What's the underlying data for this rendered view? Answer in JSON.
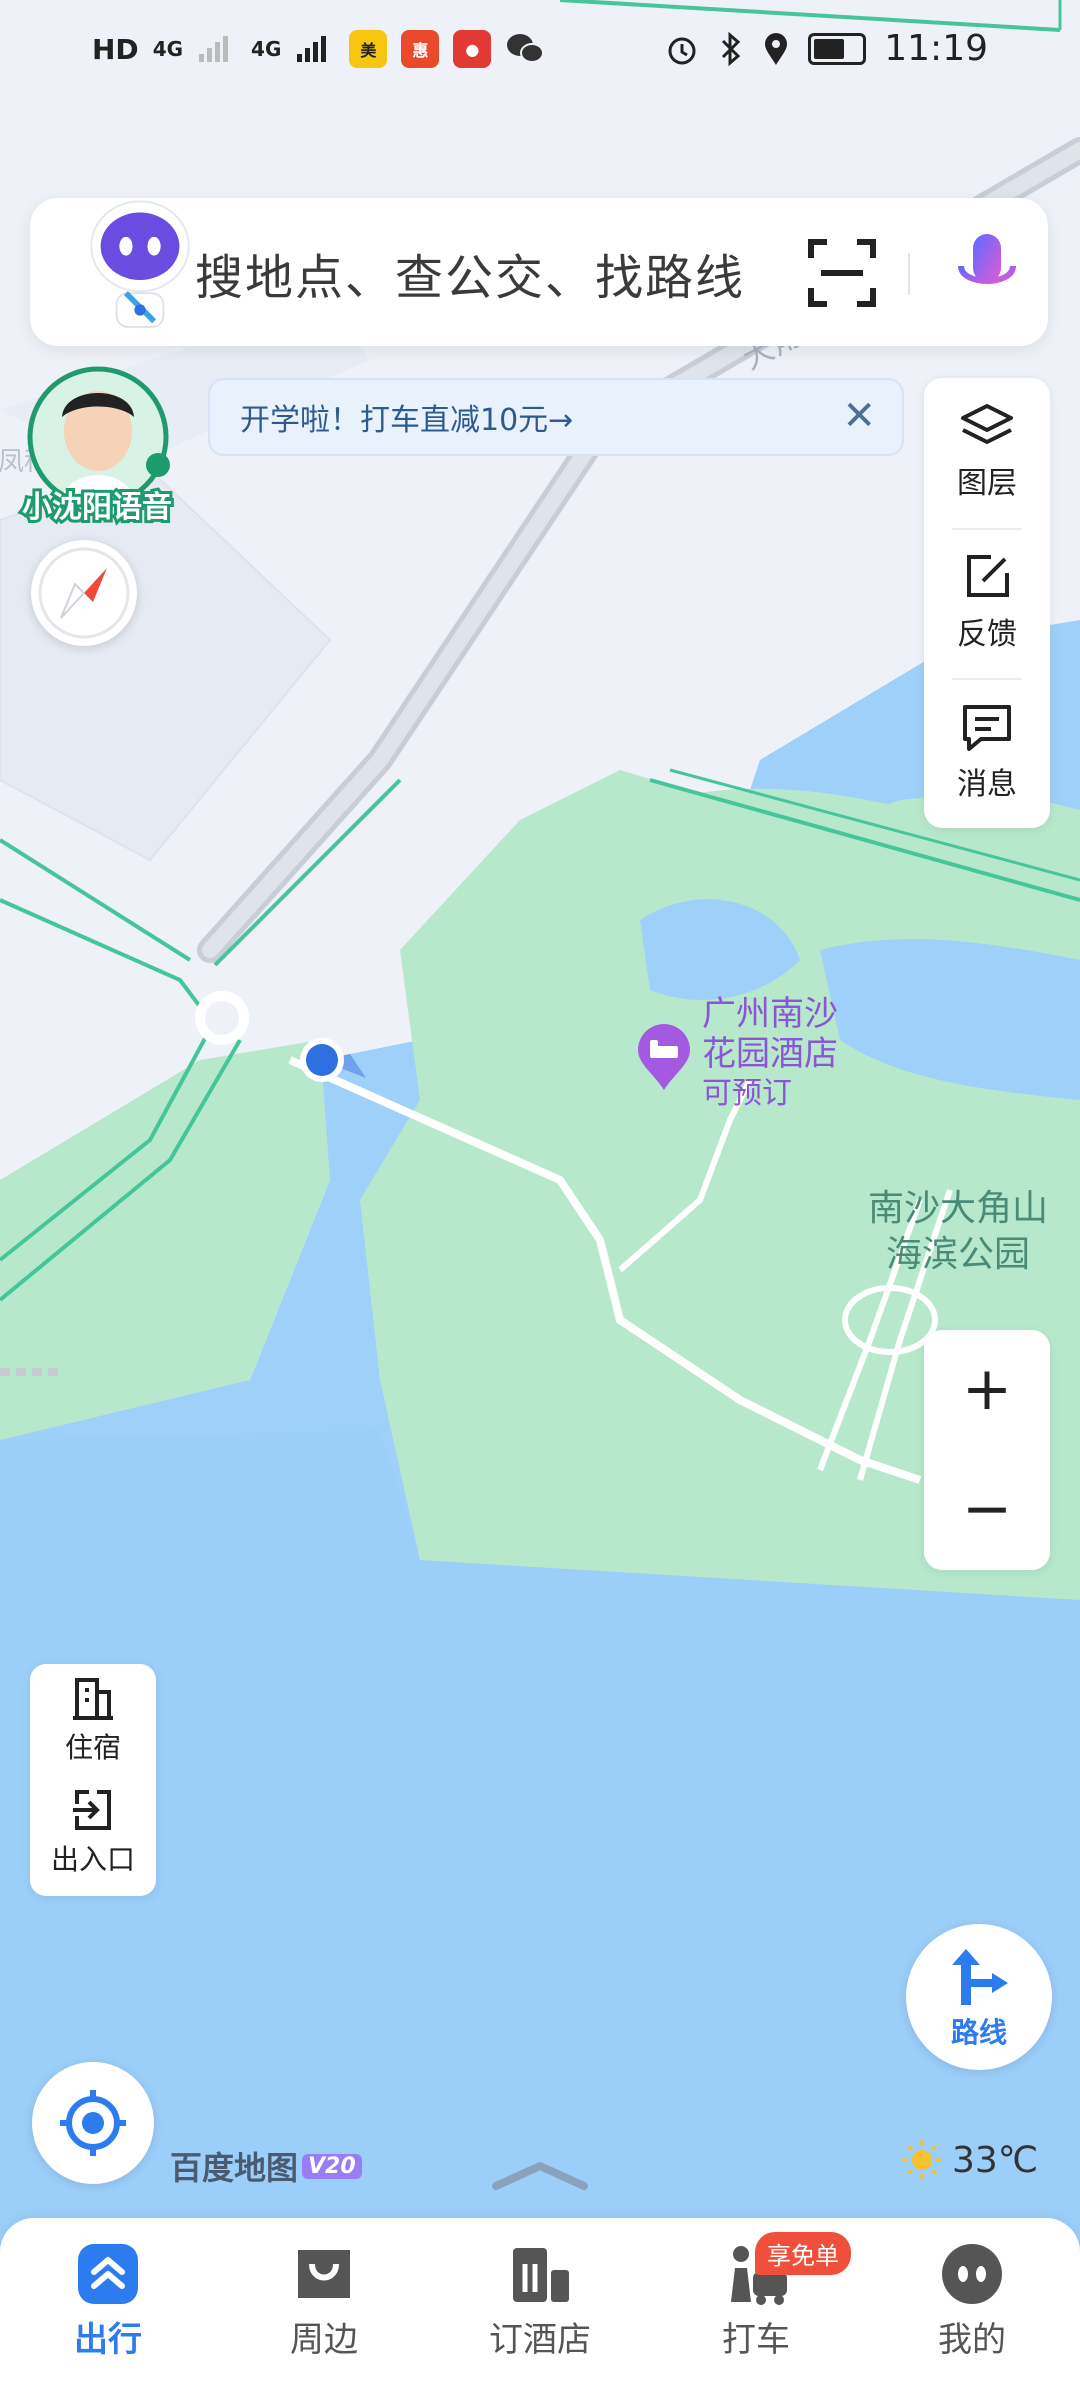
{
  "status_bar": {
    "hd": "HD",
    "net1": "4G",
    "net2": "4G",
    "time": "11:19",
    "apps": [
      "meituan-icon",
      "app-red-icon",
      "recorder-icon",
      "wechat-icon"
    ]
  },
  "search": {
    "placeholder": "搜地点、查公交、找路线"
  },
  "voice": {
    "label": "小沈阳语音"
  },
  "promo": {
    "text": "开学啦！打车直减10元→",
    "close": "✕"
  },
  "tools": {
    "layers": "图层",
    "feedback": "反馈",
    "messages": "消息"
  },
  "map": {
    "poi_name_line1": "广州南沙",
    "poi_name_line2": "花园酒店",
    "poi_status": "可预订",
    "park_line1": "南沙大角山",
    "park_line2": "海滨公园"
  },
  "zoom": {
    "plus": "+",
    "minus": "−"
  },
  "lodging": {
    "stay": "住宿",
    "entrance": "出入口"
  },
  "route": {
    "label": "路线"
  },
  "brand": {
    "name": "百度地图",
    "version": "V20"
  },
  "weather": {
    "temp": "33℃"
  },
  "nav": {
    "items": [
      {
        "label": "出行",
        "icon": "travel-icon"
      },
      {
        "label": "周边",
        "icon": "nearby-icon"
      },
      {
        "label": "订酒店",
        "icon": "hotel-icon"
      },
      {
        "label": "打车",
        "icon": "taxi-icon"
      },
      {
        "label": "我的",
        "icon": "profile-icon"
      }
    ],
    "badge": "享免单",
    "active_color": "#2c7bef"
  }
}
